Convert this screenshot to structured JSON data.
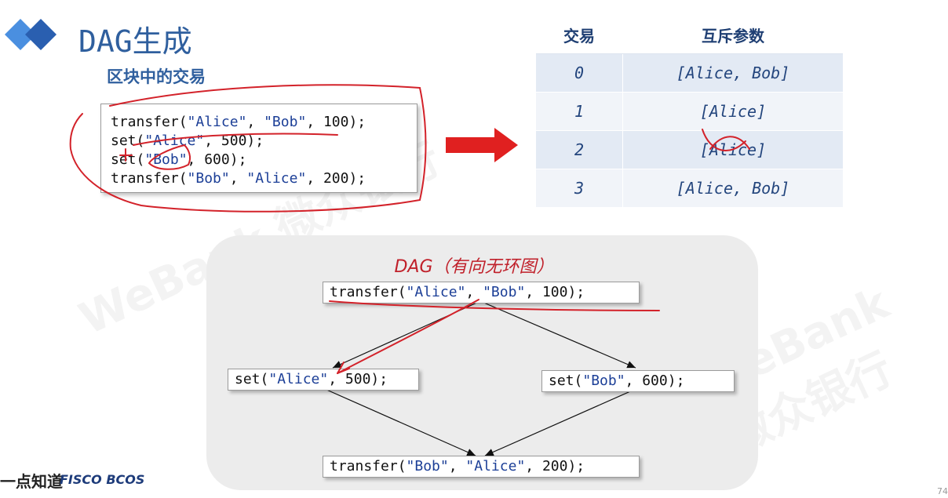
{
  "slide": {
    "title": "DAG生成",
    "subtitle": "区块中的交易"
  },
  "code_block": {
    "lines": [
      {
        "pre": "transfer(",
        "a": "\"Alice\"",
        "mid": ", ",
        "b": "\"Bob\"",
        "post": ", 100);"
      },
      {
        "pre": "set(",
        "a": "\"Alice\"",
        "mid": "",
        "b": "",
        "post": ", 500);"
      },
      {
        "pre": "set(",
        "a": "\"Bob\"",
        "mid": "",
        "b": "",
        "post": ", 600);"
      },
      {
        "pre": "transfer(",
        "a": "\"Bob\"",
        "mid": ", ",
        "b": "\"Alice\"",
        "post": ", 200);"
      }
    ]
  },
  "table": {
    "headers": [
      "交易",
      "互斥参数"
    ],
    "rows": [
      {
        "tx": "0",
        "params": "[Alice, Bob]"
      },
      {
        "tx": "1",
        "params": "[Alice]"
      },
      {
        "tx": "2",
        "params": "[Alice]"
      },
      {
        "tx": "3",
        "params": "[Alice, Bob]"
      }
    ]
  },
  "dag": {
    "title": "DAG（有向无环图）",
    "nodes": [
      {
        "id": "n0",
        "pre": "transfer(",
        "a": "\"Alice\"",
        "mid": ", ",
        "b": "\"Bob\"",
        "post": ", 100);"
      },
      {
        "id": "n1",
        "pre": "set(",
        "a": "\"Alice\"",
        "mid": "",
        "b": "",
        "post": ", 500);"
      },
      {
        "id": "n2",
        "pre": "set(",
        "a": "\"Bob\"",
        "mid": "",
        "b": "",
        "post": ", 600);"
      },
      {
        "id": "n3",
        "pre": "transfer(",
        "a": "\"Bob\"",
        "mid": ", ",
        "b": "\"Alice\"",
        "post": ", 200);"
      }
    ],
    "edges": [
      [
        "n0",
        "n1"
      ],
      [
        "n0",
        "n2"
      ],
      [
        "n1",
        "n3"
      ],
      [
        "n2",
        "n3"
      ]
    ]
  },
  "footer": {
    "logo_text": "一点知道",
    "brand": "FISCO BCOS",
    "page": "74"
  },
  "colors": {
    "accent_blue": "#2f5f9e",
    "annotation_red": "#d3222a",
    "arrow_red": "#e02020"
  },
  "watermark": "WeBank 微众银行"
}
